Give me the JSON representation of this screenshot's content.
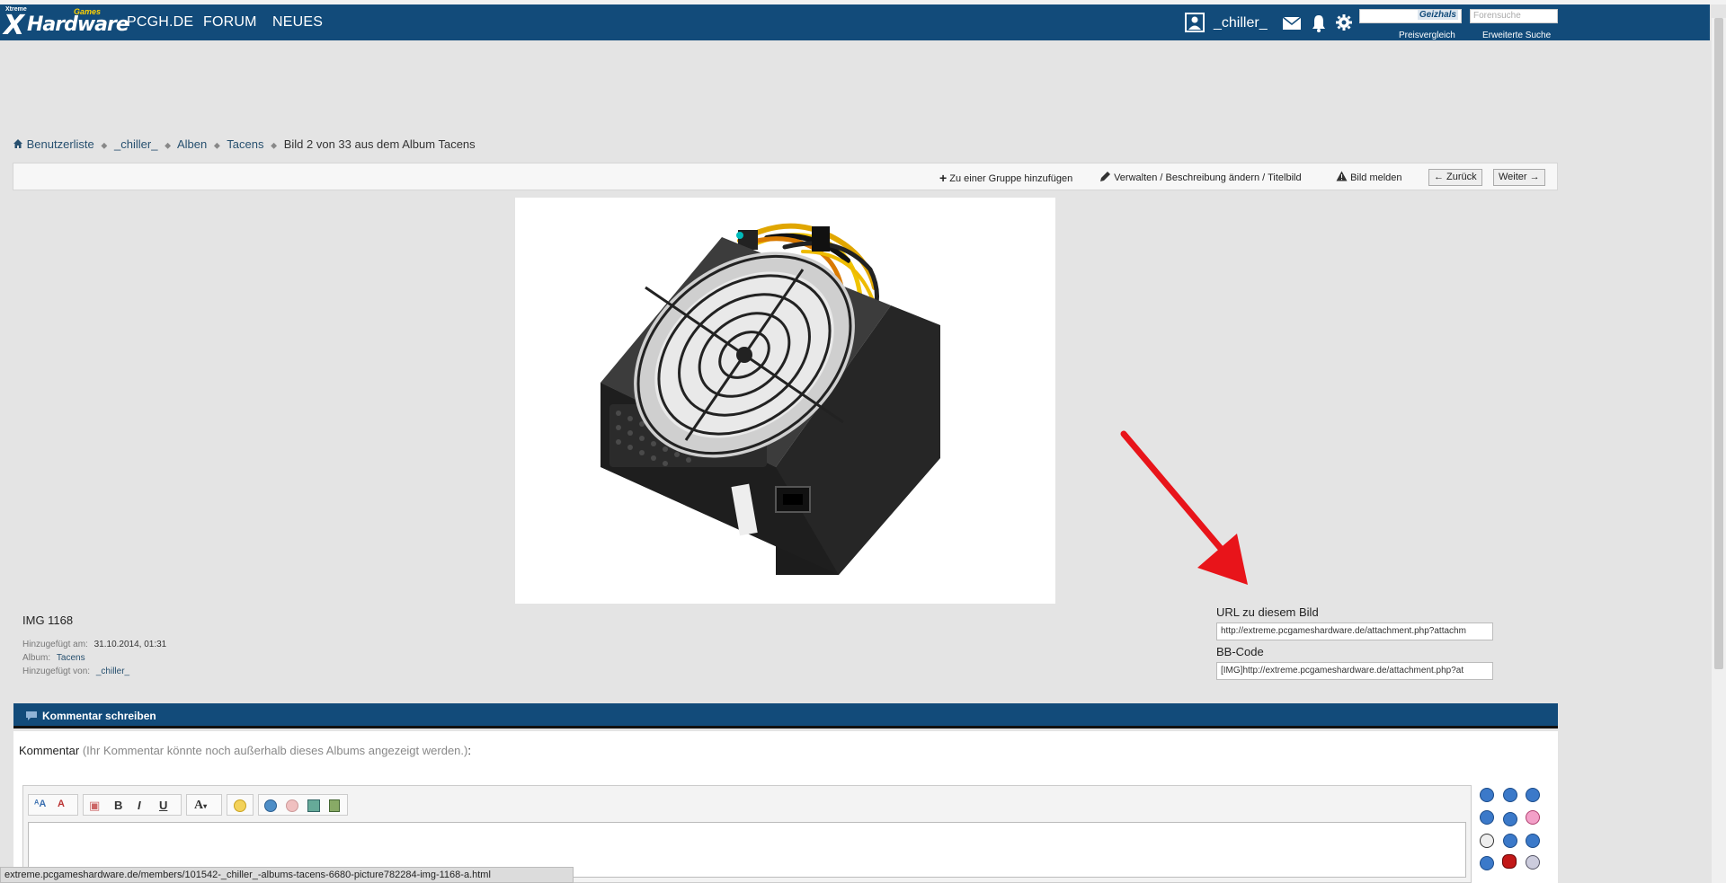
{
  "header": {
    "logo_x": "X",
    "logo_xtreme": "Xtreme",
    "logo_hardware": "Hardware",
    "logo_games": "Games",
    "nav": [
      "PCGH.DE",
      "FORUM",
      "NEUES"
    ],
    "username": "_chiller_",
    "geizhals_label": "Geizhals",
    "forum_search_placeholder": "Forensuche",
    "preisvergleich_link": "Preisvergleich",
    "advanced_search_link": "Erweiterte Suche"
  },
  "breadcrumb": {
    "items": [
      "Benutzerliste",
      "_chiller_",
      "Alben",
      "Tacens"
    ],
    "current": "Bild 2 von 33 aus dem Album Tacens"
  },
  "actions": {
    "add_group": "Zu einer Gruppe hinzufügen",
    "manage": "Verwalten / Beschreibung ändern / Titelbild",
    "report": "Bild melden",
    "back": "← Zurück",
    "next": "Weiter →"
  },
  "image_info": {
    "title": "IMG 1168",
    "added_on_label": "Hinzugefügt am:",
    "added_on_value": "31.10.2014, 01:31",
    "album_label": "Album:",
    "album_value": "Tacens",
    "added_by_label": "Hinzugefügt von:",
    "added_by_value": "_chiller_"
  },
  "share": {
    "url_label": "URL zu diesem Bild",
    "url_value": "http://extreme.pcgameshardware.de/attachment.php?attachm",
    "bbcode_label": "BB-Code",
    "bbcode_value": "[IMG]http://extreme.pcgameshardware.de/attachment.php?at"
  },
  "comment": {
    "bar_title": "Kommentar schreiben",
    "label": "Kommentar",
    "hint": "(Ihr Kommentar könnte noch außerhalb dieses Albums angezeigt werden.)",
    "colon": ":",
    "tb_bold": "B",
    "tb_italic": "I",
    "tb_underline": "U",
    "tb_font": "A",
    "tb_font_size": "A"
  },
  "status_url": "extreme.pcgameshardware.de/members/101542-_chiller_-albums-tacens-6680-picture782284-img-1168-a.html",
  "colors": {
    "header_blue": "#124b7a",
    "link_blue": "#27506f",
    "arrow_red": "#e8141a"
  }
}
